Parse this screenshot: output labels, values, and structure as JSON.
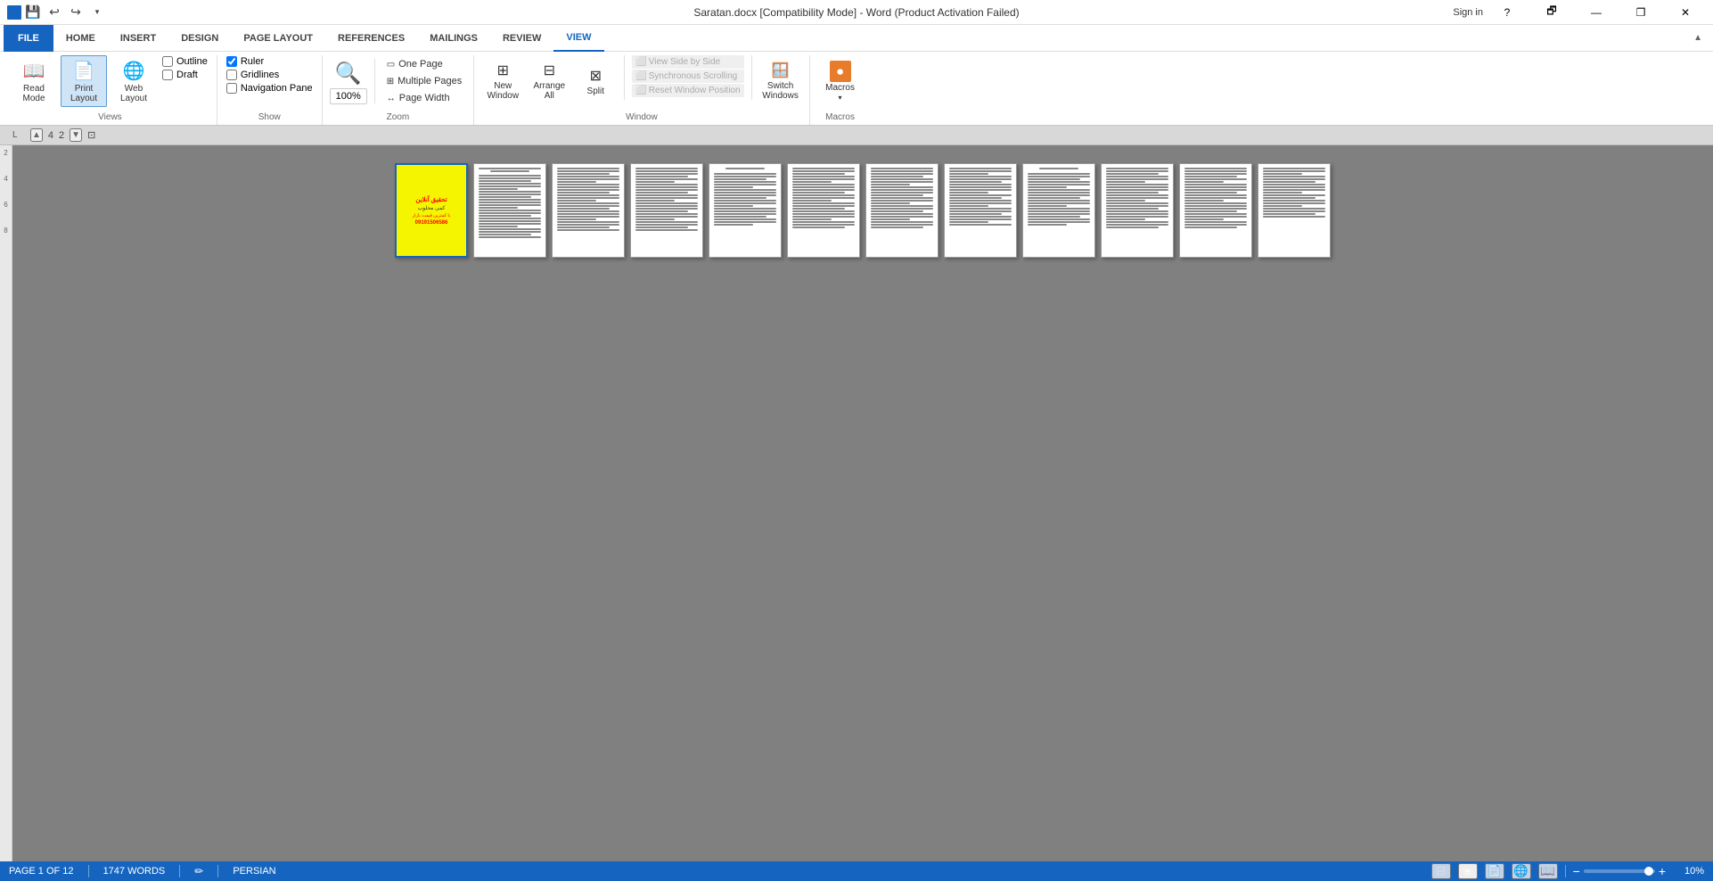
{
  "titleBar": {
    "title": "Saratan.docx [Compatibility Mode] - Word (Product Activation Failed)",
    "helpBtn": "?",
    "restoreBtn": "🗗",
    "minimizeBtn": "—",
    "closeBtn": "✕",
    "signIn": "Sign in"
  },
  "quickAccess": {
    "saveIcon": "💾",
    "undoIcon": "↩",
    "redoIcon": "↪",
    "customizeIcon": "▾"
  },
  "ribbon": {
    "tabs": [
      "FILE",
      "HOME",
      "INSERT",
      "DESIGN",
      "PAGE LAYOUT",
      "REFERENCES",
      "MAILINGS",
      "REVIEW",
      "VIEW"
    ],
    "activeTab": "VIEW",
    "groups": {
      "views": {
        "label": "Views",
        "buttons": [
          {
            "id": "read-mode",
            "label": "Read\nMode",
            "icon": "📖"
          },
          {
            "id": "print-layout",
            "label": "Print\nLayout",
            "icon": "📄"
          },
          {
            "id": "web-layout",
            "label": "Web\nLayout",
            "icon": "🌐"
          }
        ],
        "checks": [
          {
            "id": "outline",
            "label": "Outline",
            "checked": false
          },
          {
            "id": "draft",
            "label": "Draft",
            "checked": false
          }
        ]
      },
      "show": {
        "label": "Show",
        "checks": [
          {
            "id": "ruler",
            "label": "Ruler",
            "checked": true
          },
          {
            "id": "gridlines",
            "label": "Gridlines",
            "checked": false
          },
          {
            "id": "nav-pane",
            "label": "Navigation Pane",
            "checked": false
          }
        ]
      },
      "zoom": {
        "label": "Zoom",
        "zoomIcon": "🔍",
        "zoomLabel": "Zoom",
        "pct": "100%",
        "buttons": [
          {
            "id": "one-page",
            "label": "One Page",
            "icon": ""
          },
          {
            "id": "multiple-pages",
            "label": "Multiple Pages",
            "icon": ""
          },
          {
            "id": "page-width",
            "label": "Page Width",
            "icon": ""
          }
        ]
      },
      "window": {
        "label": "Window",
        "buttons": [
          {
            "id": "new-window",
            "label": "New\nWindow",
            "icon": "⊞"
          },
          {
            "id": "arrange-all",
            "label": "Arrange\nAll",
            "icon": "⊟"
          },
          {
            "id": "split",
            "label": "Split",
            "icon": "⊠"
          }
        ],
        "subButtons": [
          {
            "id": "view-side-by-side",
            "label": "View Side by Side",
            "disabled": true
          },
          {
            "id": "sync-scrolling",
            "label": "Synchronous Scrolling",
            "disabled": true
          },
          {
            "id": "reset-window",
            "label": "Reset Window Position",
            "disabled": true
          }
        ],
        "switchWindows": {
          "label": "Switch\nWindows",
          "icon": "🪟"
        }
      },
      "macros": {
        "label": "Macros",
        "icon": "⏺",
        "label2": "Macros"
      }
    }
  },
  "pageIndicator": {
    "prevArrow": "▲",
    "num1": "4",
    "num2": "2",
    "nextArrow": "▼",
    "selectIcon": "⊡"
  },
  "document": {
    "pageCount": 12,
    "pages": [
      {
        "id": 1,
        "type": "cover"
      },
      {
        "id": 2,
        "type": "text"
      },
      {
        "id": 3,
        "type": "text"
      },
      {
        "id": 4,
        "type": "text"
      },
      {
        "id": 5,
        "type": "text"
      },
      {
        "id": 6,
        "type": "text"
      },
      {
        "id": 7,
        "type": "text"
      },
      {
        "id": 8,
        "type": "text"
      },
      {
        "id": 9,
        "type": "text"
      },
      {
        "id": 10,
        "type": "text"
      },
      {
        "id": 11,
        "type": "text"
      },
      {
        "id": 12,
        "type": "text"
      }
    ]
  },
  "statusBar": {
    "pageInfo": "PAGE 1 OF 12",
    "wordCount": "1747 WORDS",
    "language": "PERSIAN",
    "views": [
      "normal",
      "outline",
      "print",
      "web",
      "read"
    ],
    "zoomMinus": "−",
    "zoomPlus": "+",
    "zoomValue": "10%"
  },
  "sideRuler": {
    "marks": [
      "2",
      "4",
      "6",
      "8"
    ]
  }
}
